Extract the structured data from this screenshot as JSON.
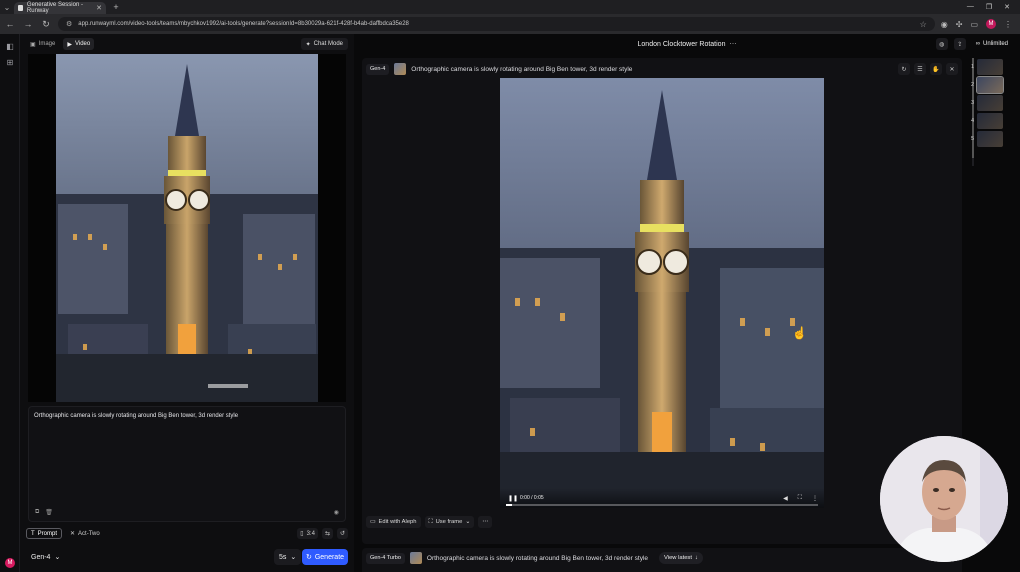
{
  "browser": {
    "tab_title": "Generative Session - Runway",
    "url": "app.runwayml.com/video-tools/teams/mbychkov1992/ai-tools/generate?sessionId=8b30029a-621f-428f-b4ab-daffbdca35e28",
    "profile_initial": "M"
  },
  "left_panel": {
    "mode_tabs": [
      {
        "label": "Image",
        "icon": "image-icon",
        "active": false
      },
      {
        "label": "Video",
        "icon": "video-icon",
        "active": true
      }
    ],
    "chat_mode_label": "Chat Mode",
    "prompt_text": "Orthographic camera is slowly rotating around Big Ben tower, 3d render style",
    "sub_tabs": [
      {
        "label": "Prompt",
        "active": true
      },
      {
        "label": "Act-Two",
        "active": false
      }
    ],
    "aspect_ratio": "3:4",
    "model": "Gen-4",
    "duration": "5s",
    "generate_label": "Generate",
    "user_initial": "M"
  },
  "right_panel": {
    "session_title": "London Clocktower Rotation",
    "unlimited_label": "Unlimited",
    "generation": {
      "model_badge": "Gen-4",
      "prompt": "Orthographic camera is slowly rotating around Big Ben tower, 3d render style",
      "time_display": "0:00 / 0:05",
      "progress": 0.02,
      "footer_buttons": [
        "Edit with Aleph",
        "Use frame"
      ]
    },
    "next_generation": {
      "model_badge": "Gen-4 Turbo",
      "prompt": "Orthographic camera is slowly rotating around Big Ben tower, 3d render style",
      "view_latest_label": "View latest"
    },
    "timeline": [
      "1",
      "2",
      "3",
      "4",
      "5"
    ],
    "active_timeline_index": 1
  }
}
